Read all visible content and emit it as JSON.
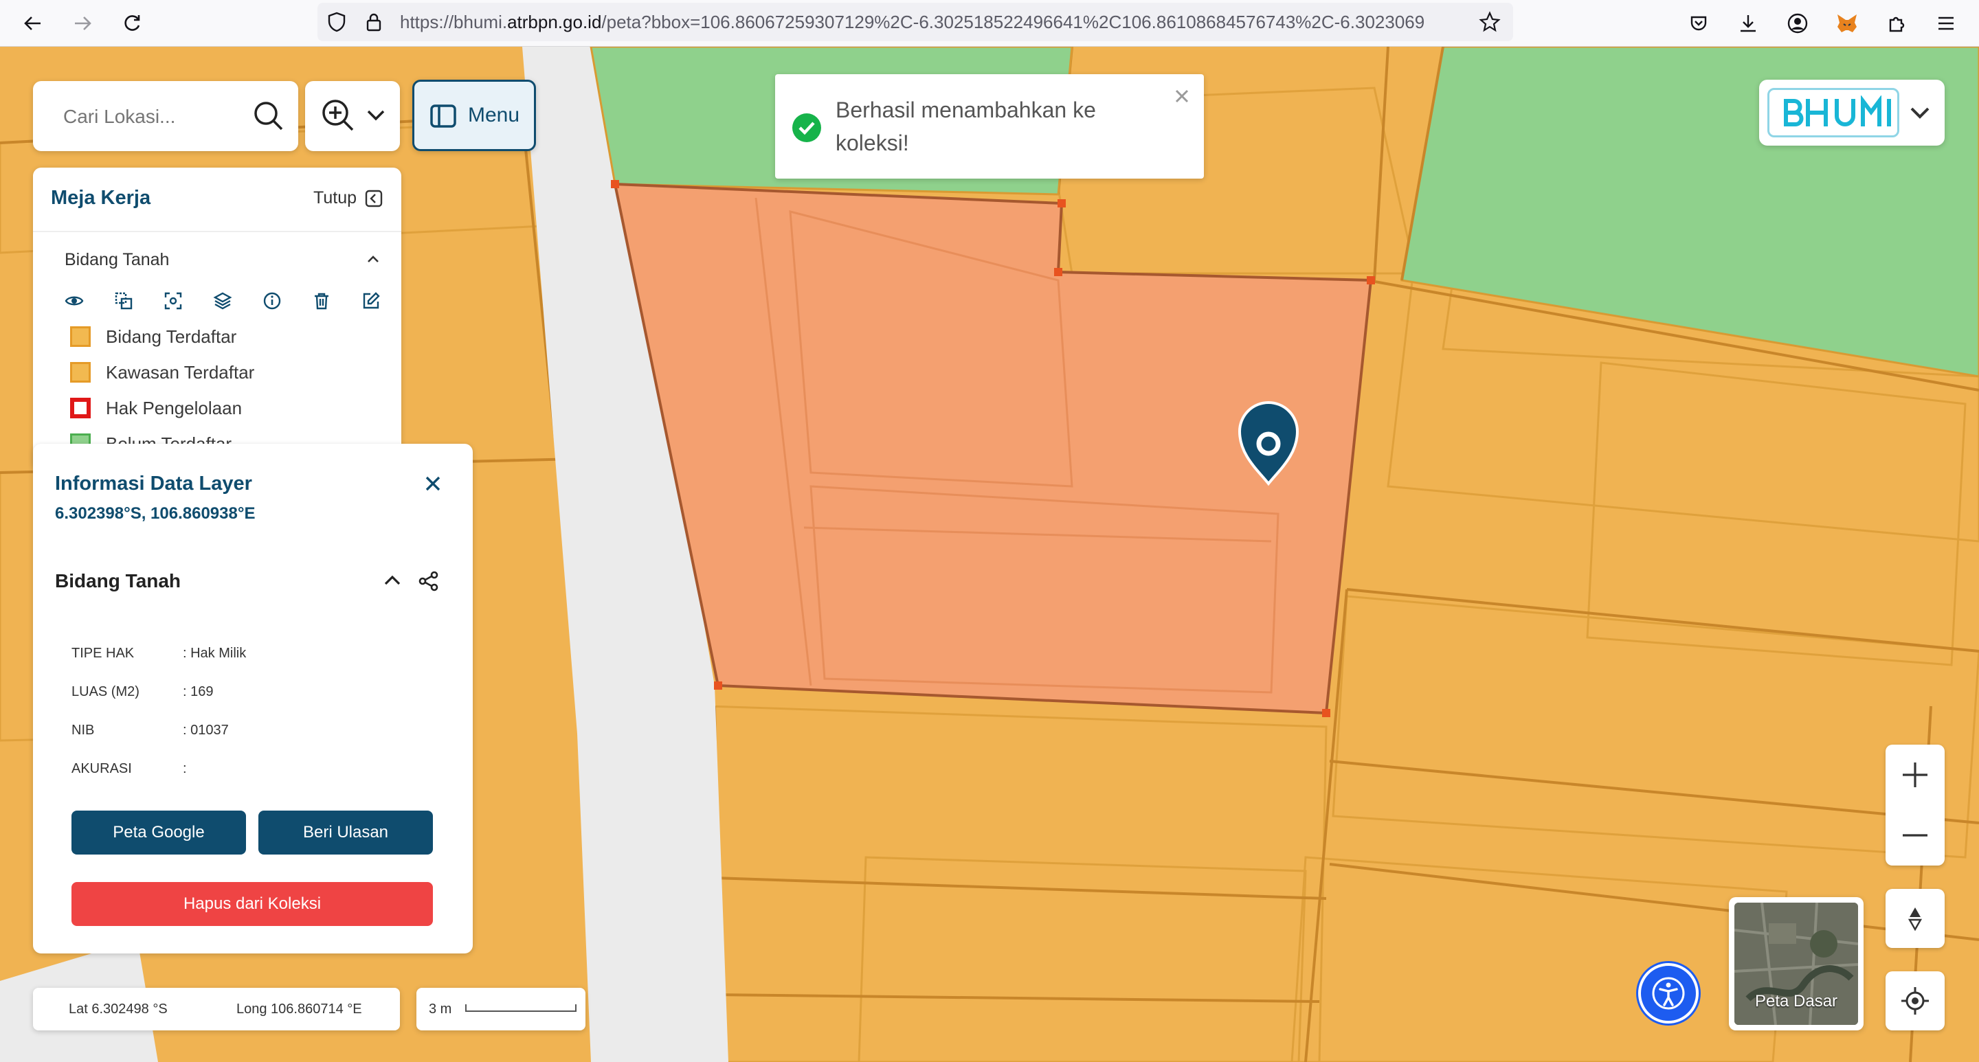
{
  "browser": {
    "url_prefix": "https://bhumi.",
    "url_domain": "atrbpn.go.id",
    "url_rest": "/peta?bbox=106.86067259307129%2C-6.302518522496641%2C106.86108684576743%2C-6.3023069"
  },
  "search": {
    "placeholder": "Cari Lokasi..."
  },
  "menu_label": "Menu",
  "toast": {
    "message": "Berhasil menambahkan ke koleksi!"
  },
  "logo": {
    "text": "BHUMI"
  },
  "workspace": {
    "title": "Meja Kerja",
    "close_label": "Tutup",
    "section_title": "Bidang Tanah",
    "legend": [
      {
        "label": "Bidang Terdaftar"
      },
      {
        "label": "Kawasan Terdaftar"
      },
      {
        "label": "Hak Pengelolaan"
      },
      {
        "label": "Belum Terdaftar"
      }
    ]
  },
  "info": {
    "title": "Informasi Data Layer",
    "coords": "6.302398°S, 106.860938°E",
    "section_title": "Bidang Tanah",
    "rows": [
      {
        "label": "TIPE HAK",
        "value": ": Hak Milik"
      },
      {
        "label": "LUAS (M2)",
        "value": ": 169"
      },
      {
        "label": "NIB",
        "value": ": 01037"
      },
      {
        "label": "AKURASI",
        "value": ":"
      }
    ],
    "btn_google": "Peta Google",
    "btn_review": "Beri Ulasan",
    "btn_remove": "Hapus dari Koleksi"
  },
  "status": {
    "lat": "Lat 6.302498 °S",
    "long": "Long 106.860714 °E",
    "scale": "3 m"
  },
  "basemap": {
    "label": "Peta Dasar"
  },
  "colors": {
    "parcel_registered": "#f2b950",
    "parcel_selected": "#f4a070",
    "green_area": "#8fd18c",
    "road": "#ebebeb",
    "primary": "#0f4c6e",
    "danger": "#ef4444",
    "accessibility": "#1d5cf0"
  }
}
